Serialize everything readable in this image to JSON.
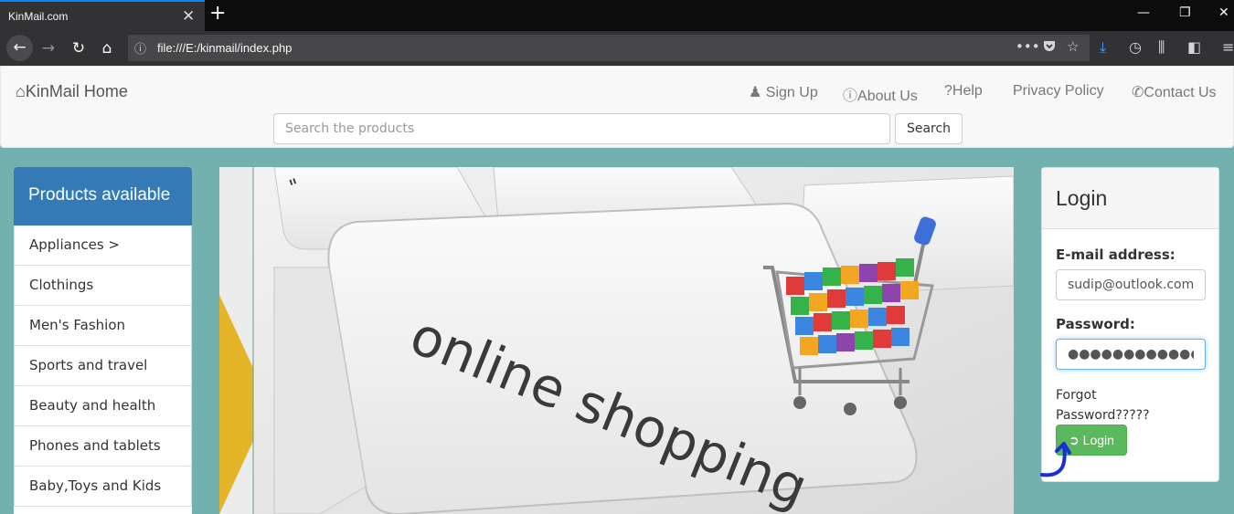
{
  "browser": {
    "tab_title": "KinMail.com",
    "tab_close": "✕",
    "new_tab": "+",
    "url": "file:///E:/kinmail/index.php",
    "icons": [
      "back-icon",
      "forward-icon",
      "reload-icon",
      "home-icon",
      "info-icon",
      "more-icon",
      "pocket-icon",
      "bookmark-star-icon",
      "download-icon",
      "history-icon",
      "library-icon",
      "sidebar-icon",
      "menu-icon"
    ]
  },
  "site": {
    "brand": "KinMail Home",
    "nav": {
      "signup": "Sign Up",
      "about": "About Us",
      "help": "Help",
      "privacy": "Privacy Policy",
      "contact": "Contact Us"
    },
    "search": {
      "placeholder": "Search the products",
      "button": "Search"
    }
  },
  "categories": {
    "title": "Products available",
    "items": [
      "Appliances >",
      "Clothings",
      "Men's Fashion",
      "Sports and travel",
      "Beauty and health",
      "Phones and tablets",
      "Baby,Toys and Kids"
    ]
  },
  "banner": {
    "key_text": "online shopping"
  },
  "login": {
    "title": "Login",
    "email_label": "E-mail address:",
    "email_value": "sudip@outlook.com",
    "password_label": "Password:",
    "password_value": "●●●●●●●●●●●●",
    "forgot": "Forgot Password?????",
    "button": "Login"
  },
  "colors": {
    "page_bg": "#72b1ae",
    "primary": "#337ab7",
    "success": "#5cb85c",
    "annotation": "#1a2fd6"
  }
}
